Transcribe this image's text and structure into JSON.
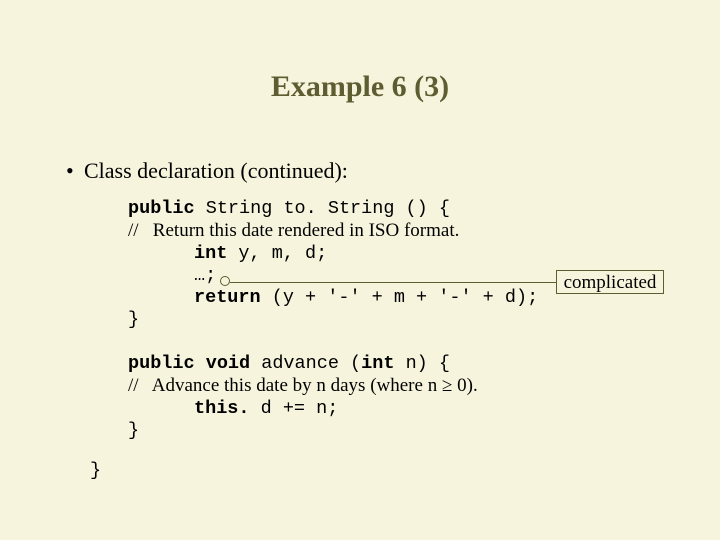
{
  "title": "Example 6 (3)",
  "bullet": {
    "mark": "•",
    "text": "Class declaration (continued):"
  },
  "code": {
    "l1a": "public",
    "l1b": " String to. String () {",
    "l2": "//   Return this date rendered in ISO format.",
    "l3a": "int",
    "l3b": " y, m, d;",
    "l4": "…;",
    "l5a": "return",
    "l5b": " (y + '-' + m + '-' + d);",
    "l6": "}",
    "l7a": "public void",
    "l7b": " advance (",
    "l7c": "int",
    "l7d": " n) {",
    "l8": "//   Advance this date by n days (where n ≥ 0).",
    "l9a": "this.",
    "l9b": " d += n;",
    "l10": "}",
    "close": "}"
  },
  "annotation": "complicated"
}
